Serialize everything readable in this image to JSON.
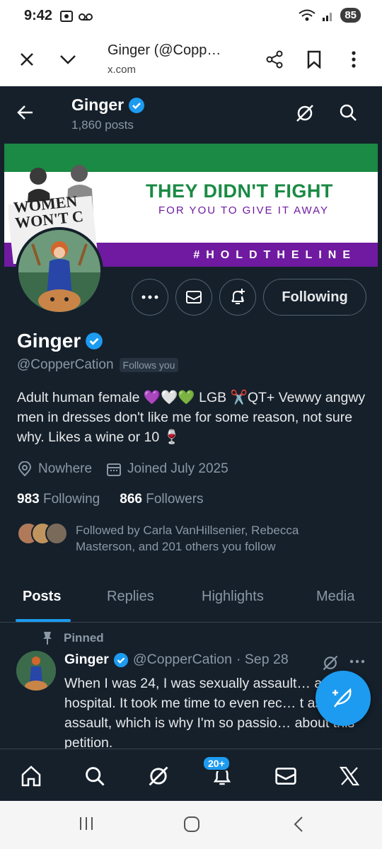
{
  "status_bar": {
    "time": "9:42",
    "battery": "85"
  },
  "browser": {
    "page_title": "Ginger (@Copp…",
    "domain": "x.com"
  },
  "header": {
    "name": "Ginger",
    "posts_count": "1,860 posts"
  },
  "banner": {
    "headline": "THEY DIDN'T FIGHT",
    "subline": "FOR YOU TO GIVE IT AWAY",
    "hashtag": "#HOLDTHELINE",
    "sign_text": "WOMEN WON'T C"
  },
  "profile": {
    "name": "Ginger",
    "handle": "@CopperCation",
    "follows_you": "Follows you",
    "bio": "Adult human female 💜🤍💚 LGB ✂️QT+ Vewwy angwy men in dresses don't like me for some reason, not sure why. Likes a wine or 10 🍷",
    "location": "Nowhere",
    "joined": "Joined July 2025",
    "following_count": "983",
    "following_label": "Following",
    "followers_count": "866",
    "followers_label": "Followers",
    "followed_by": "Followed by Carla VanHillsenier, Rebecca Masterson, and 201 others you follow",
    "follow_button": "Following"
  },
  "tabs": [
    "Posts",
    "Replies",
    "Highlights",
    "Media"
  ],
  "pinned_post": {
    "pinned_label": "Pinned",
    "name": "Ginger",
    "handle": "@CopperCation",
    "date": "· Sep 28",
    "text": "When I was 24, I was sexually assault… a hospital. It took me time to even rec… t as assault, which is why I'm so passio… about this petition."
  },
  "bottom_nav": {
    "notifications_badge": "20+"
  },
  "colors": {
    "background": "#15202b",
    "accent": "#1d9bf0",
    "muted": "#8b98a5",
    "banner_green": "#1a8a44",
    "banner_purple": "#6f1aa0"
  }
}
